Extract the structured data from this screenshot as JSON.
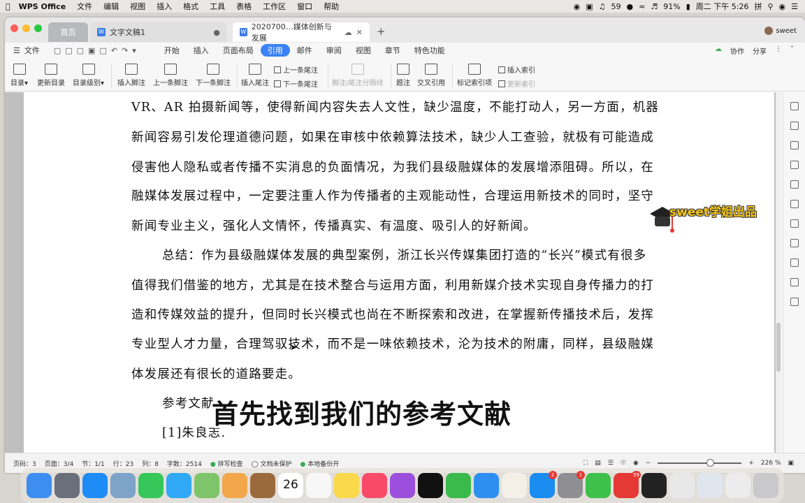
{
  "menubar": {
    "app_name": "WPS Office",
    "items": [
      "文件",
      "编辑",
      "视图",
      "插入",
      "格式",
      "工具",
      "表格",
      "工作区",
      "窗口",
      "帮助"
    ],
    "notification_count": "59",
    "battery": "91%",
    "clock": "周二 下午 5:26",
    "input_method": "拼"
  },
  "tabs": {
    "home": "首页",
    "doc1": "文字文稿1",
    "doc2": "2020700…媒体创新与发展",
    "user": "sweet"
  },
  "menu": {
    "file": "文件",
    "tabs": [
      "开始",
      "插入",
      "页面布局",
      "引用",
      "邮件",
      "审阅",
      "视图",
      "章节",
      "特色功能"
    ],
    "collab": "协作",
    "share": "分享"
  },
  "ribbon": {
    "toc": "目录",
    "update_toc": "更新目录",
    "toc_level": "目录级别",
    "insert_footnote": "插入脚注",
    "prev_footnote": "上一条脚注",
    "next_footnote": "下一条脚注",
    "insert_endnote": "插入尾注",
    "prev_endnote": "上一条尾注",
    "next_endnote": "下一条尾注",
    "separator": "脚注/尾注分隔线",
    "caption": "题注",
    "crossref": "交叉引用",
    "mark_index": "标记索引项",
    "insert_index": "插入索引",
    "update_index": "更新索引"
  },
  "document": {
    "lines": [
      "VR、AR 拍摄新闻等，使得新闻内容失去人文性，缺少温度，不能打动人，另一方面，机器",
      "新闻容易引发伦理道德问题，如果在审核中依赖算法技术，缺少人工查验，就极有可能造成",
      "侵害他人隐私或者传播不实消息的负面情况，为我们县级融媒体的发展增添阻碍。所以，在",
      "融媒体发展过程中，一定要注重人作为传播者的主观能动性，合理运用新技术的同时，坚守",
      "新闻专业主义，强化人文情怀，传播真实、有温度、吸引人的好新闻。",
      "总结：作为县级融媒体发展的典型案例，浙江长兴传媒集团打造的“长兴”模式有很多",
      "值得我们借鉴的地方，尤其是在技术整合与运用方面，利用新媒介技术实现自身传播力的打",
      "造和传媒效益的提升，但同时长兴模式也尚在不断探索和改进，在掌握新传播技术后，发挥",
      "专业型人才力量，合理驾驭技术，而不是一味依赖技术，沦为技术的附庸，同样，县级融媒",
      "体发展还有很长的道路要走。",
      "参考文献：",
      "[1]朱良志."
    ],
    "subtitle": "首先找到我们的参考文献",
    "watermark": "sweet学姐出品"
  },
  "status": {
    "page_code": "页码：3",
    "page": "页面：3/4",
    "section": "节：1/1",
    "row": "行：23",
    "col": "列：8",
    "words": "字数：2514",
    "spell": "拼写检查",
    "protect": "文档未保护",
    "backup": "本地备份开",
    "zoom": "226 %"
  },
  "dock": {
    "calendar_day": "26",
    "appstore_badge": "2",
    "settings_badge": "1",
    "wps_badge": "59"
  },
  "colors": {
    "accent": "#3b82f6",
    "watermark": "#f7c61a"
  }
}
